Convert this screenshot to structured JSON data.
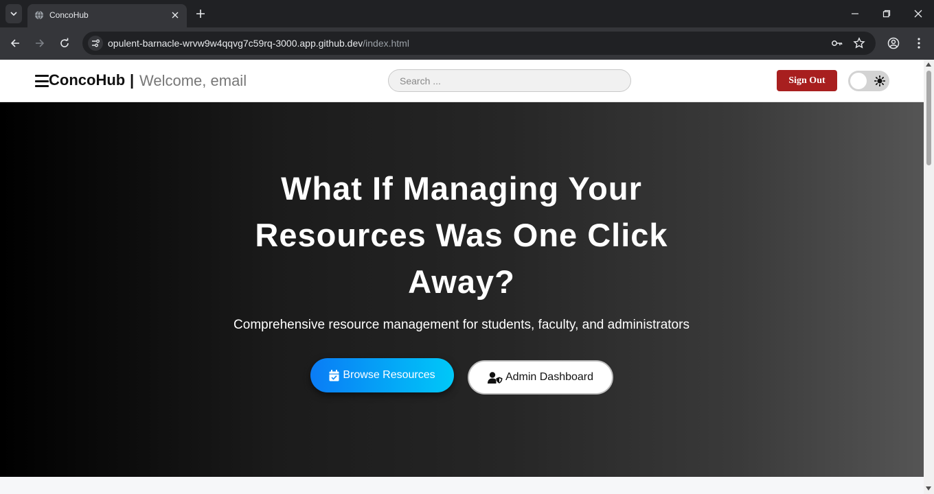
{
  "browser": {
    "tab_title": "ConcoHub",
    "url_host": "opulent-barnacle-wrvw9w4qqvg7c59rq-3000.app.github.dev",
    "url_path": "/index.html"
  },
  "header": {
    "brand": "ConcoHub",
    "separator": "|",
    "welcome": "Welcome, email",
    "search_placeholder": "Search ...",
    "signout_label": "Sign Out",
    "signout_color": "#a81f1f"
  },
  "hero": {
    "title": "What If Managing Your Resources Was One Click Away?",
    "subtitle": "Comprehensive resource management for students, faculty, and administrators",
    "browse_label": "Browse Resources",
    "admin_label": "Admin Dashboard",
    "browse_gradient": [
      "#0a7cf5",
      "#00c8f8"
    ]
  },
  "icons": {
    "browse": "calendar-check-icon",
    "admin": "user-shield-icon",
    "theme": "sun-icon",
    "menu": "hamburger-icon"
  }
}
